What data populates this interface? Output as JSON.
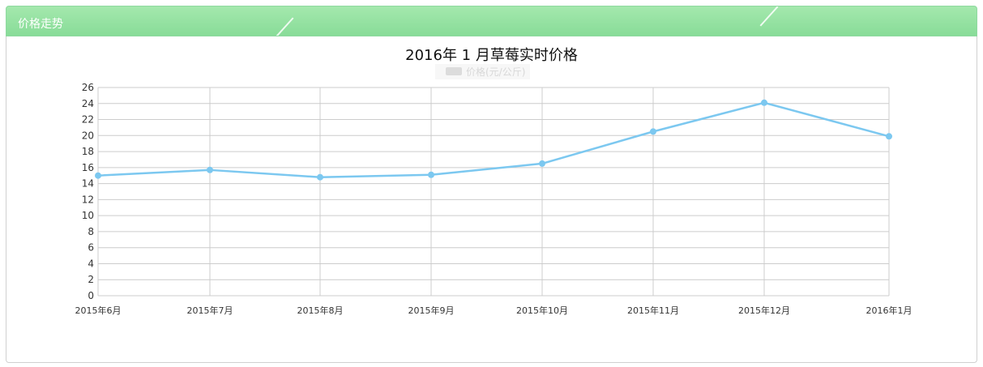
{
  "panel": {
    "title": "价格走势"
  },
  "colors": {
    "header": "#8fdc9c",
    "line": "#7cc8f0",
    "grid": "#cccccc"
  },
  "chart_data": {
    "type": "line",
    "title": "2016年 1 月草莓实时价格",
    "categories": [
      "2015年6月",
      "2015年7月",
      "2015年8月",
      "2015年9月",
      "2015年10月",
      "2015年11月",
      "2015年12月",
      "2016年1月"
    ],
    "series": [
      {
        "name": "价格(元/公斤)",
        "values": [
          15.0,
          15.7,
          14.8,
          15.1,
          16.5,
          20.5,
          24.1,
          19.9
        ]
      }
    ],
    "ylim": [
      0,
      26
    ],
    "yticks": [
      0,
      2,
      4,
      6,
      8,
      10,
      12,
      14,
      16,
      18,
      20,
      22,
      24,
      26
    ],
    "grid": true,
    "legend": "top-center"
  }
}
